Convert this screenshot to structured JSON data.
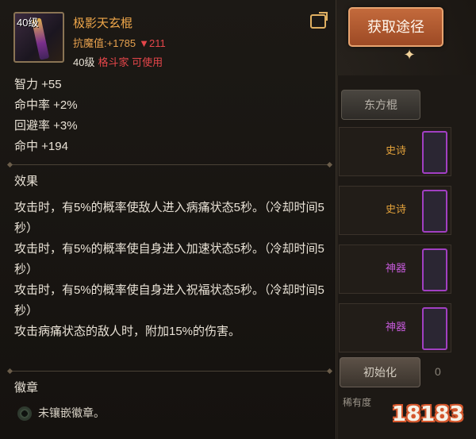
{
  "background": {
    "tab_label": "东方棍",
    "items": [
      {
        "rarity": "史诗",
        "color": "#e2a13a"
      },
      {
        "rarity": "史诗",
        "color": "#e2a13a"
      },
      {
        "rarity": "神器",
        "color": "#c45ad8"
      },
      {
        "rarity": "神器",
        "color": "#c45ad8"
      }
    ],
    "enhance_label": "初始化",
    "sub_label": "稀有度",
    "count_label": "0"
  },
  "acquire_button": "获取途径",
  "item": {
    "level_badge": "40级",
    "name": "极影天玄棍",
    "magic_label": "抗魔值:",
    "magic_value": "+1785",
    "magic_diff": "▼211",
    "req_level": "40级",
    "req_class": "格斗家 可使用"
  },
  "attributes": [
    {
      "label": "智力 +55"
    },
    {
      "label": "命中率 +2%"
    },
    {
      "label": "回避率 +3%"
    },
    {
      "label": "命中 +194"
    }
  ],
  "effects_title": "效果",
  "effects": [
    "攻击时，有5%的概率使敌人进入病痛状态5秒。（冷却时间5秒）",
    "攻击时，有5%的概率使自身进入加速状态5秒。（冷却时间5秒）",
    "攻击时，有5%的概率使自身进入祝福状态5秒。（冷却时间5秒）",
    "攻击病痛状态的敌人时，附加15%的伤害。"
  ],
  "emblem_title": "徽章",
  "emblem_status": "未镶嵌徽章。",
  "watermark": "18183",
  "colors": {
    "accent": "#f0a74a",
    "negative": "#e5464a",
    "button": "#b0562d"
  }
}
